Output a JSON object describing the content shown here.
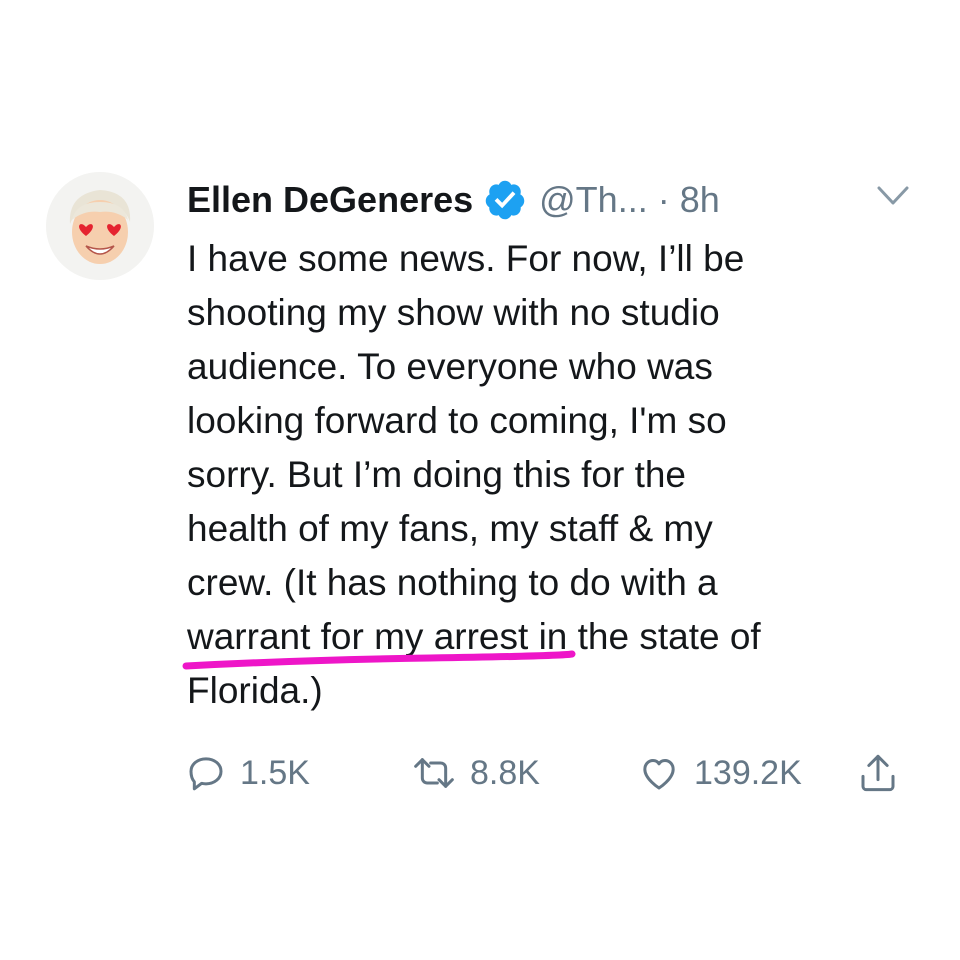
{
  "tweet": {
    "author_name": "Ellen DeGeneres",
    "handle": "@Th...",
    "separator": "·",
    "time": "8h",
    "verified": true,
    "text": "I have some news. For now, I’ll be\nshooting my show with no studio\naudience. To everyone who was\nlooking forward to coming, I'm so\nsorry. But I’m doing this for the\nhealth of my fans, my staff & my\ncrew. (It has nothing to do with a\nwarrant for my arrest in the state of\nFlorida.)",
    "highlight_color": "#ee16c8"
  },
  "actions": {
    "reply_count": "1.5K",
    "retweet_count": "8.8K",
    "like_count": "139.2K"
  },
  "icons": {
    "reply": "reply-icon",
    "retweet": "retweet-icon",
    "like": "heart-icon",
    "share": "share-icon",
    "more": "chevron-down-icon",
    "verified": "verified-badge-icon"
  },
  "colors": {
    "text": "#14171a",
    "secondary": "#657786",
    "verified_blue": "#1da1f2"
  }
}
